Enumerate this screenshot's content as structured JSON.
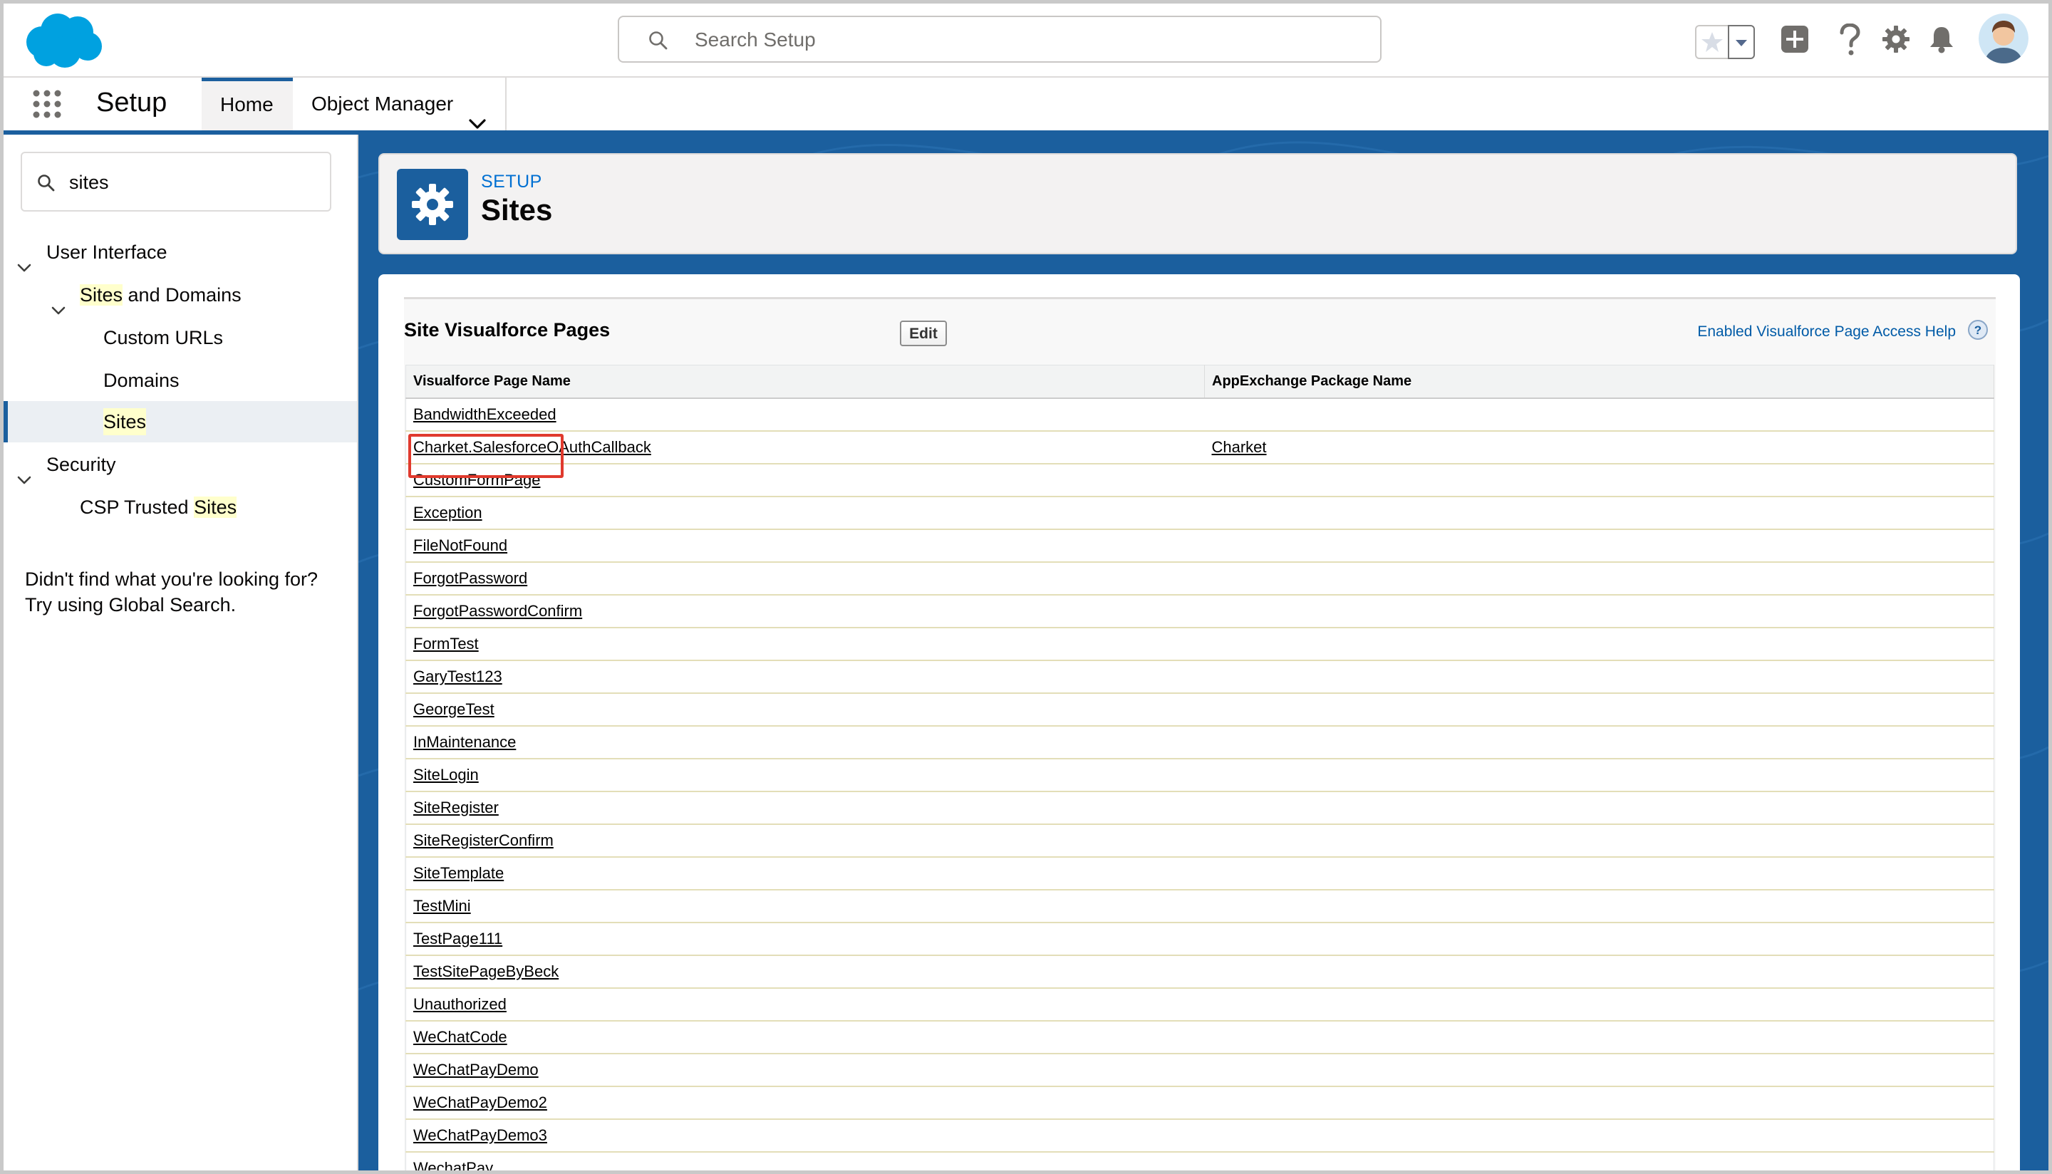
{
  "header": {
    "search_placeholder": "Search Setup",
    "icons": [
      "salesforce-cloud-logo",
      "search-icon",
      "favorites-star-icon",
      "favorites-dropdown-icon",
      "global-actions-plus-icon",
      "help-question-icon",
      "setup-gear-icon",
      "notifications-bell-icon",
      "user-avatar"
    ]
  },
  "context_bar": {
    "app_name": "Setup",
    "tabs": [
      {
        "label": "Home",
        "active": true
      },
      {
        "label": "Object Manager",
        "has_menu": true
      }
    ]
  },
  "sidebar": {
    "quickfind_value": "sites",
    "tree": {
      "user_interface": "User Interface",
      "sites_and_domains_hl": "Sites",
      "sites_and_domains_rest": " and Domains",
      "custom_urls": "Custom URLs",
      "domains": "Domains",
      "sites": "Sites",
      "security": "Security",
      "csp_prefix": "CSP Trusted ",
      "csp_hl": "Sites"
    },
    "not_found_line1": "Didn't find what you're looking for?",
    "not_found_line2": "Try using Global Search."
  },
  "page_header": {
    "breadcrumb": "SETUP",
    "title": "Sites"
  },
  "block": {
    "title": "Site Visualforce Pages",
    "edit_label": "Edit",
    "help_link": "Enabled Visualforce Page Access Help",
    "columns": [
      "Visualforce Page Name",
      "AppExchange Package Name"
    ],
    "rows": [
      {
        "name": "BandwidthExceeded",
        "package": ""
      },
      {
        "name": "Charket.SalesforceOAuthCallback",
        "package": "Charket"
      },
      {
        "name": "CustomFormPage",
        "package": ""
      },
      {
        "name": "Exception",
        "package": ""
      },
      {
        "name": "FileNotFound",
        "package": ""
      },
      {
        "name": "ForgotPassword",
        "package": ""
      },
      {
        "name": "ForgotPasswordConfirm",
        "package": ""
      },
      {
        "name": "FormTest",
        "package": ""
      },
      {
        "name": "GaryTest123",
        "package": ""
      },
      {
        "name": "GeorgeTest",
        "package": ""
      },
      {
        "name": "InMaintenance",
        "package": ""
      },
      {
        "name": "SiteLogin",
        "package": ""
      },
      {
        "name": "SiteRegister",
        "package": ""
      },
      {
        "name": "SiteRegisterConfirm",
        "package": ""
      },
      {
        "name": "SiteTemplate",
        "package": ""
      },
      {
        "name": "TestMini",
        "package": ""
      },
      {
        "name": "TestPage111",
        "package": ""
      },
      {
        "name": "TestSitePageByBeck",
        "package": ""
      },
      {
        "name": "Unauthorized",
        "package": ""
      },
      {
        "name": "WeChatCode",
        "package": ""
      },
      {
        "name": "WeChatPayDemo",
        "package": ""
      },
      {
        "name": "WeChatPayDemo2",
        "package": ""
      },
      {
        "name": "WeChatPayDemo3",
        "package": ""
      },
      {
        "name": "WechatPay",
        "package": ""
      }
    ]
  },
  "colors": {
    "brand_blue": "#1b5f9e",
    "link_blue": "#0070d2",
    "highlight_red": "#e03a2d",
    "cloud_blue": "#00a1e0"
  }
}
